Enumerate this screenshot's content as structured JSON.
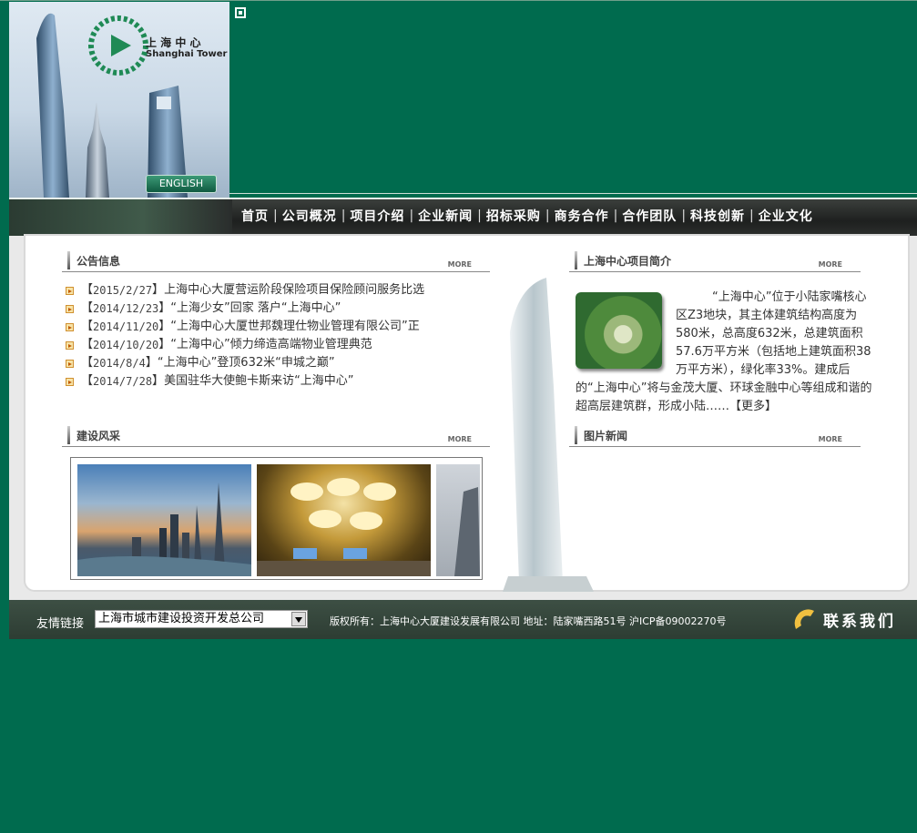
{
  "header": {
    "logo_cn": "上 海 中 心",
    "logo_en": "Shanghai Tower",
    "english_button": "ENGLISH"
  },
  "nav": {
    "items": [
      "首页",
      "公司概况",
      "项目介绍",
      "企业新闻",
      "招标采购",
      "商务合作",
      "合作团队",
      "科技创新",
      "企业文化"
    ],
    "separator": "|"
  },
  "notices": {
    "title": "公告信息",
    "more": "MORE",
    "items": [
      {
        "date": "2015/2/27",
        "text": "上海中心大厦营运阶段保险项目保险顾问服务比选"
      },
      {
        "date": "2014/12/23",
        "text": "“上海少女”回家 落户“上海中心”"
      },
      {
        "date": "2014/11/20",
        "text": "“上海中心大厦世邦魏理仕物业管理有限公司”正"
      },
      {
        "date": "2014/10/20",
        "text": "“上海中心”倾力缔造高端物业管理典范"
      },
      {
        "date": "2014/8/4",
        "text": "“上海中心”登顶632米“申城之巅”"
      },
      {
        "date": "2014/7/28",
        "text": "美国驻华大使鲍卡斯来访“上海中心”"
      }
    ]
  },
  "construction": {
    "title": "建设风采",
    "more": "MORE"
  },
  "intro": {
    "title": "上海中心项目简介",
    "more": "MORE",
    "text": "“上海中心”位于小陆家嘴核心区Z3地块，其主体建筑结构高度为580米，总高度632米，总建筑面积57.6万平方米（包括地上建筑面积38万平方米），绿化率33%。建成后的“上海中心”将与金茂大厦、环球金融中心等组成和谐的超高层建筑群，形成小陆……",
    "more_link": "【更多】"
  },
  "photo_news": {
    "title": "图片新闻",
    "more": "MORE"
  },
  "footer": {
    "links_label": "友情链接",
    "select_value": "上海市城市建设投资开发总公司",
    "copyright": "版权所有：上海中心大厦建设发展有限公司 地址：陆家嘴西路51号  沪ICP备09002270号",
    "contact": "联系我们"
  },
  "colors": {
    "page_bg": "#006b4e",
    "nav_bg": "#1e201f"
  }
}
